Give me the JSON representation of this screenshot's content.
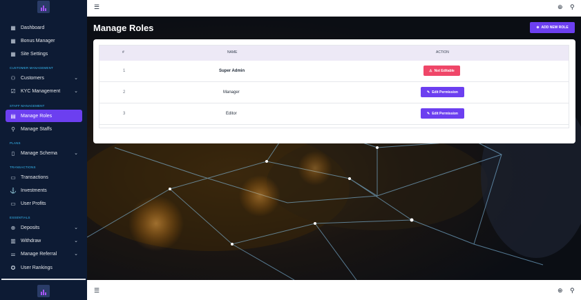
{
  "sidebar": {
    "items": [
      {
        "label": "Dashboard",
        "icon": "grid-icon"
      },
      {
        "label": "Bonus Manager",
        "icon": "grid-icon"
      },
      {
        "label": "Site Settings",
        "icon": "grid-icon"
      },
      {
        "label": "Customers",
        "icon": "users-icon"
      },
      {
        "label": "KYC Management",
        "icon": "check-square-icon"
      },
      {
        "label": "Manage Roles",
        "icon": "card-icon"
      },
      {
        "label": "Manage Staffs",
        "icon": "user-plus-icon"
      },
      {
        "label": "Manage Schema",
        "icon": "book-icon"
      },
      {
        "label": "Transactions",
        "icon": "receipt-icon"
      },
      {
        "label": "Investments",
        "icon": "anchor-icon"
      },
      {
        "label": "User Profits",
        "icon": "card-icon"
      },
      {
        "label": "Deposits",
        "icon": "plus-circle-icon"
      },
      {
        "label": "Withdraw",
        "icon": "bank-icon"
      },
      {
        "label": "Manage Referral",
        "icon": "sliders-icon"
      },
      {
        "label": "User Rankings",
        "icon": "award-icon"
      }
    ],
    "sections": {
      "customer": "CUSTOMER MANAGEMENT",
      "staff": "STAFF MANAGEMENT",
      "plans": "PLANS",
      "transactions": "TRANSACTIONS",
      "essentials": "ESSENTIALS"
    }
  },
  "header": {
    "title": "Manage Roles",
    "add_button": "ADD NEW ROLE"
  },
  "table": {
    "columns": [
      "#",
      "NAME",
      "ACTION"
    ],
    "rows": [
      {
        "num": "1",
        "name": "Super Admin",
        "action": "Not Editable"
      },
      {
        "num": "2",
        "name": "Manager",
        "action": "Edit Permission"
      },
      {
        "num": "3",
        "name": "Editor",
        "action": "Edit Permission"
      }
    ]
  },
  "colors": {
    "sidebar": "#0d1b34",
    "accent": "#6c3ff0",
    "danger": "#ef4668",
    "section_label": "#38bdf8"
  }
}
